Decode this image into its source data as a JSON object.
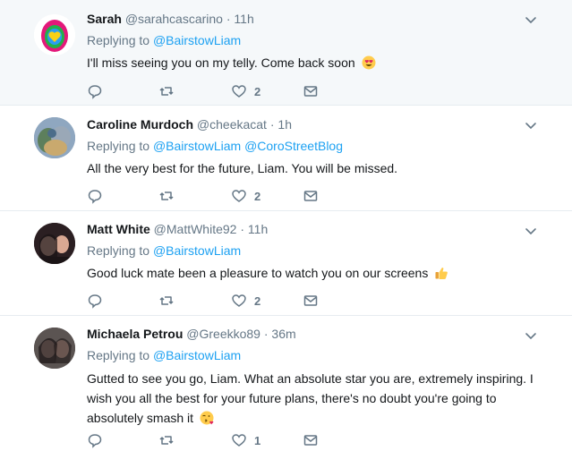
{
  "tweets": [
    {
      "name": "Sarah",
      "handle": "@sarahcascarino",
      "time": "11h",
      "replying_label": "Replying to",
      "mentions": [
        "@BairstowLiam"
      ],
      "text": "I'll miss seeing you on my telly. Come back soon",
      "emoji": "smiling-face-with-heart-eyes",
      "likes": "2"
    },
    {
      "name": "Caroline Murdoch",
      "handle": "@cheekacat",
      "time": "1h",
      "replying_label": "Replying to",
      "mentions": [
        "@BairstowLiam",
        "@CoroStreetBlog"
      ],
      "text": "All the very best for the future, Liam. You will be missed.",
      "likes": "2"
    },
    {
      "name": "Matt White",
      "handle": "@MattWhite92",
      "time": "11h",
      "replying_label": "Replying to",
      "mentions": [
        "@BairstowLiam"
      ],
      "text": "Good luck mate been a pleasure to watch you on our screens",
      "emoji": "thumbs-up",
      "likes": "2"
    },
    {
      "name": "Michaela Petrou",
      "handle": "@Greekko89",
      "time": "36m",
      "replying_label": "Replying to",
      "mentions": [
        "@BairstowLiam"
      ],
      "text_lines": [
        "Gutted to see you go, Liam. What an absolute star you are, extremely inspiring. I",
        "wish you all the best for your future plans, there's no doubt you're going to",
        "absolutely smash it"
      ],
      "emoji": "face-blowing-a-kiss",
      "likes": "1"
    }
  ],
  "separator": "·",
  "colors": {
    "accent": "#1da1f2",
    "muted": "#657786",
    "highlight": "#f5f8fa",
    "border": "#e6ecf0"
  }
}
